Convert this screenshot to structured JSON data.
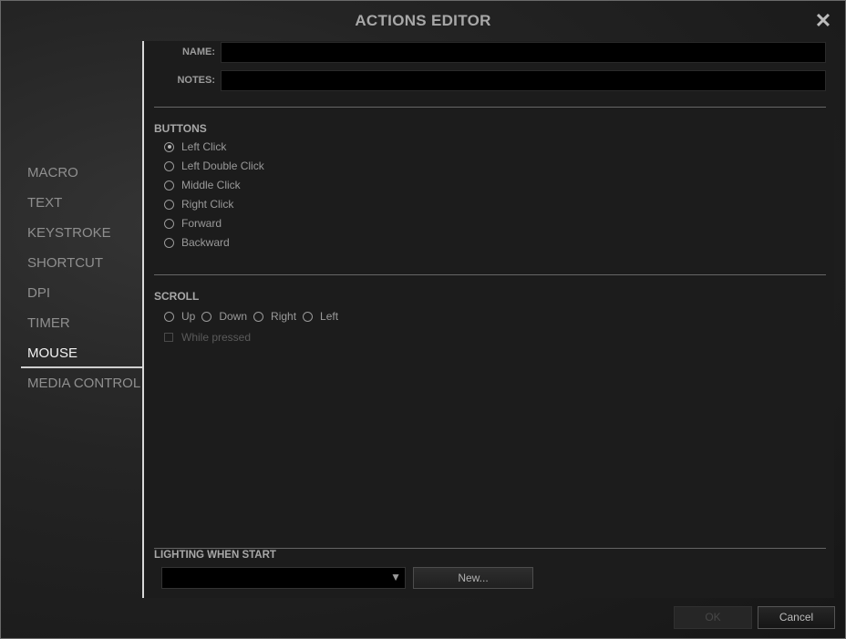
{
  "window": {
    "title": "ACTIONS EDITOR",
    "close_glyph": "✕"
  },
  "nav": {
    "items": [
      {
        "label": "MACRO"
      },
      {
        "label": "TEXT"
      },
      {
        "label": "KEYSTROKE"
      },
      {
        "label": "SHORTCUT"
      },
      {
        "label": "DPI"
      },
      {
        "label": "TIMER"
      },
      {
        "label": "MOUSE",
        "active": true
      },
      {
        "label": "MEDIA CONTROL"
      }
    ]
  },
  "form": {
    "name_label": "NAME:",
    "name_value": "",
    "notes_label": "NOTES:",
    "notes_value": ""
  },
  "buttons_section": {
    "title": "BUTTONS",
    "options": [
      {
        "label": "Left Click",
        "checked": true
      },
      {
        "label": "Left Double Click",
        "checked": false
      },
      {
        "label": "Middle Click",
        "checked": false
      },
      {
        "label": "Right Click",
        "checked": false
      },
      {
        "label": "Forward",
        "checked": false
      },
      {
        "label": "Backward",
        "checked": false
      }
    ]
  },
  "scroll_section": {
    "title": "SCROLL",
    "options": [
      {
        "label": "Up",
        "checked": false
      },
      {
        "label": "Down",
        "checked": false
      },
      {
        "label": "Right",
        "checked": false
      },
      {
        "label": "Left",
        "checked": false
      }
    ],
    "while_pressed_label": "While pressed",
    "while_pressed_checked": false
  },
  "lighting": {
    "title": "LIGHTING WHEN START",
    "selected": "",
    "arrow_glyph": "▼",
    "new_label": "New..."
  },
  "footer": {
    "ok_label": "OK",
    "cancel_label": "Cancel"
  }
}
